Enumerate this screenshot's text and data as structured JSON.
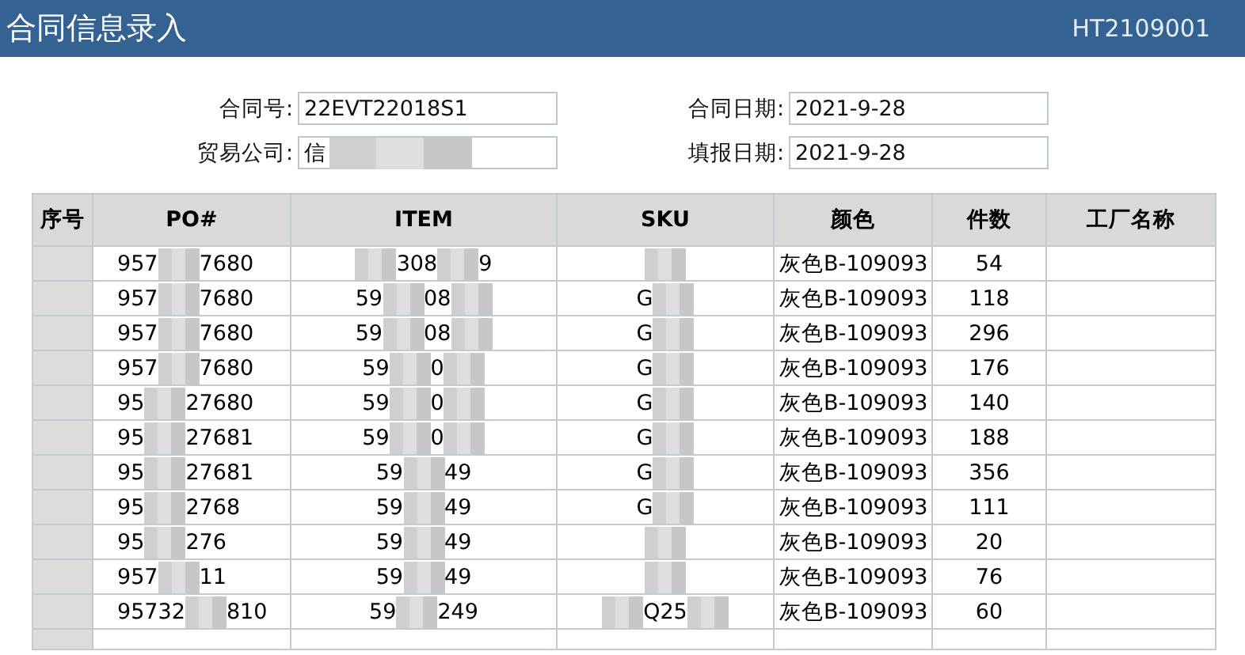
{
  "window": {
    "title": "合同信息录入",
    "code": "HT2109001"
  },
  "form": [
    {
      "label": "合同号:",
      "value": [
        {
          "kind": "text",
          "text": "22EVT22018S1"
        }
      ]
    },
    {
      "label": "合同日期:",
      "value": [
        {
          "kind": "text",
          "text": "2021-9-28"
        }
      ]
    },
    {
      "label": "贸易公司:",
      "value": [
        {
          "kind": "text",
          "text": "信"
        },
        {
          "kind": "mosaic"
        }
      ]
    },
    {
      "label": "填报日期:",
      "value": [
        {
          "kind": "text",
          "text": "2021-9-28"
        }
      ]
    }
  ],
  "table": {
    "columns": [
      "序号",
      "PO#",
      "ITEM",
      "SKU",
      "颜色",
      "件数",
      "工厂名称"
    ],
    "rows": [
      {
        "po": [
          {
            "kind": "text",
            "text": "957"
          },
          {
            "kind": "mosaic"
          },
          {
            "kind": "text",
            "text": "7680"
          }
        ],
        "item": [
          {
            "kind": "mosaic"
          },
          {
            "kind": "text",
            "text": "308"
          },
          {
            "kind": "mosaic"
          },
          {
            "kind": "text",
            "text": "9"
          }
        ],
        "sku": [
          {
            "kind": "mosaic"
          }
        ],
        "colour_name": "灰色B-109093",
        "qty": "54"
      },
      {
        "po": [
          {
            "kind": "text",
            "text": "957"
          },
          {
            "kind": "mosaic"
          },
          {
            "kind": "text",
            "text": "7680"
          }
        ],
        "item": [
          {
            "kind": "text",
            "text": "59"
          },
          {
            "kind": "mosaic"
          },
          {
            "kind": "text",
            "text": "08"
          },
          {
            "kind": "mosaic"
          }
        ],
        "sku": [
          {
            "kind": "text",
            "text": "G"
          },
          {
            "kind": "mosaic"
          }
        ],
        "colour_name": "灰色B-109093",
        "qty": "118"
      },
      {
        "po": [
          {
            "kind": "text",
            "text": "957"
          },
          {
            "kind": "mosaic"
          },
          {
            "kind": "text",
            "text": "7680"
          }
        ],
        "item": [
          {
            "kind": "text",
            "text": "59"
          },
          {
            "kind": "mosaic"
          },
          {
            "kind": "text",
            "text": "08"
          },
          {
            "kind": "mosaic"
          }
        ],
        "sku": [
          {
            "kind": "text",
            "text": "G"
          },
          {
            "kind": "mosaic"
          }
        ],
        "colour_name": "灰色B-109093",
        "qty": "296"
      },
      {
        "po": [
          {
            "kind": "text",
            "text": "957"
          },
          {
            "kind": "mosaic"
          },
          {
            "kind": "text",
            "text": "7680"
          }
        ],
        "item": [
          {
            "kind": "text",
            "text": "59"
          },
          {
            "kind": "mosaic"
          },
          {
            "kind": "text",
            "text": "0"
          },
          {
            "kind": "mosaic"
          }
        ],
        "sku": [
          {
            "kind": "text",
            "text": "G"
          },
          {
            "kind": "mosaic"
          }
        ],
        "colour_name": "灰色B-109093",
        "qty": "176"
      },
      {
        "po": [
          {
            "kind": "text",
            "text": "95"
          },
          {
            "kind": "mosaic"
          },
          {
            "kind": "text",
            "text": "27680"
          }
        ],
        "item": [
          {
            "kind": "text",
            "text": "59"
          },
          {
            "kind": "mosaic"
          },
          {
            "kind": "text",
            "text": "0"
          },
          {
            "kind": "mosaic"
          }
        ],
        "sku": [
          {
            "kind": "text",
            "text": "G"
          },
          {
            "kind": "mosaic"
          }
        ],
        "colour_name": "灰色B-109093",
        "qty": "140"
      },
      {
        "po": [
          {
            "kind": "text",
            "text": "95"
          },
          {
            "kind": "mosaic"
          },
          {
            "kind": "text",
            "text": "27681"
          }
        ],
        "item": [
          {
            "kind": "text",
            "text": "59"
          },
          {
            "kind": "mosaic"
          },
          {
            "kind": "text",
            "text": "0"
          },
          {
            "kind": "mosaic"
          }
        ],
        "sku": [
          {
            "kind": "text",
            "text": "G"
          },
          {
            "kind": "mosaic"
          }
        ],
        "colour_name": "灰色B-109093",
        "qty": "188"
      },
      {
        "po": [
          {
            "kind": "text",
            "text": "95"
          },
          {
            "kind": "mosaic"
          },
          {
            "kind": "text",
            "text": "27681"
          }
        ],
        "item": [
          {
            "kind": "text",
            "text": "59"
          },
          {
            "kind": "mosaic"
          },
          {
            "kind": "text",
            "text": "49"
          }
        ],
        "sku": [
          {
            "kind": "text",
            "text": "G"
          },
          {
            "kind": "mosaic"
          }
        ],
        "colour_name": "灰色B-109093",
        "qty": "356"
      },
      {
        "po": [
          {
            "kind": "text",
            "text": "95"
          },
          {
            "kind": "mosaic"
          },
          {
            "kind": "text",
            "text": "2768"
          }
        ],
        "item": [
          {
            "kind": "text",
            "text": "59"
          },
          {
            "kind": "mosaic"
          },
          {
            "kind": "text",
            "text": "49"
          }
        ],
        "sku": [
          {
            "kind": "text",
            "text": "G"
          },
          {
            "kind": "mosaic"
          }
        ],
        "colour_name": "灰色B-109093",
        "qty": "111"
      },
      {
        "po": [
          {
            "kind": "text",
            "text": "95"
          },
          {
            "kind": "mosaic"
          },
          {
            "kind": "text",
            "text": "276"
          }
        ],
        "item": [
          {
            "kind": "text",
            "text": "59"
          },
          {
            "kind": "mosaic"
          },
          {
            "kind": "text",
            "text": "49"
          }
        ],
        "sku": [
          {
            "kind": "mosaic"
          }
        ],
        "colour_name": "灰色B-109093",
        "qty": "20"
      },
      {
        "po": [
          {
            "kind": "text",
            "text": "957"
          },
          {
            "kind": "mosaic"
          },
          {
            "kind": "text",
            "text": "11"
          }
        ],
        "item": [
          {
            "kind": "text",
            "text": "59"
          },
          {
            "kind": "mosaic"
          },
          {
            "kind": "text",
            "text": "49"
          }
        ],
        "sku": [
          {
            "kind": "mosaic"
          }
        ],
        "colour_name": "灰色B-109093",
        "qty": "76"
      },
      {
        "po": [
          {
            "kind": "text",
            "text": "95732"
          },
          {
            "kind": "mosaic"
          },
          {
            "kind": "text",
            "text": "810"
          }
        ],
        "item": [
          {
            "kind": "text",
            "text": "59"
          },
          {
            "kind": "mosaic"
          },
          {
            "kind": "text",
            "text": "249"
          }
        ],
        "sku": [
          {
            "kind": "mosaic"
          },
          {
            "kind": "text",
            "text": "Q25"
          },
          {
            "kind": "mosaic"
          }
        ],
        "colour_name": "灰色B-109093",
        "qty": "60"
      }
    ]
  }
}
